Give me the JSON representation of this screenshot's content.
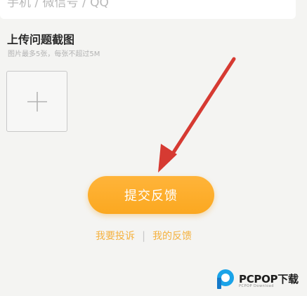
{
  "contact": {
    "placeholder": "手机 / 微信号 / QQ"
  },
  "upload": {
    "title": "上传问题截图",
    "hint": "图片最多5张，每张不超过5M",
    "add_icon": "plus-icon"
  },
  "submit": {
    "label": "提交反馈"
  },
  "links": {
    "complaint": "我要投诉",
    "divider": "|",
    "my_feedback": "我的反馈"
  },
  "watermark": {
    "brand": "PCPOP下载",
    "sub": "PCPOP Download",
    "logo_icon": "pcpop-logo-icon"
  },
  "annotation": {
    "arrow_icon": "red-arrow-icon",
    "color": "#d63a32"
  },
  "colors": {
    "accent": "#fcab26",
    "link": "#f5b240",
    "background": "#f4f4f2"
  }
}
